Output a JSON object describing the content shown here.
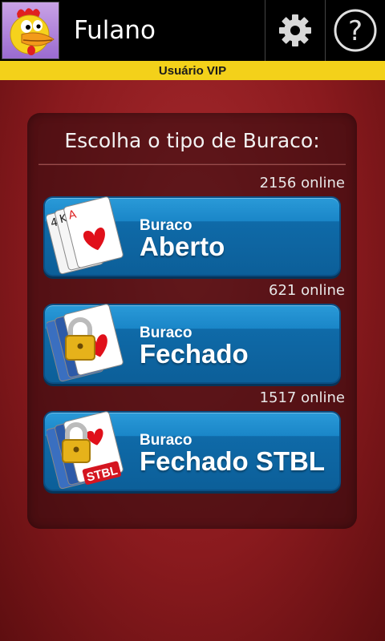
{
  "header": {
    "username": "Fulano",
    "settings_icon": "gear-icon",
    "help_icon": "question-icon",
    "vip_label": "Usuário VIP"
  },
  "panel": {
    "title": "Escolha o tipo de Buraco:",
    "options": [
      {
        "online": "2156 online",
        "subtitle": "Buraco",
        "title": "Aberto",
        "icon": "open-cards-icon"
      },
      {
        "online": "621 online",
        "subtitle": "Buraco",
        "title": "Fechado",
        "icon": "locked-cards-icon"
      },
      {
        "online": "1517 online",
        "subtitle": "Buraco",
        "title": "Fechado STBL",
        "icon": "locked-cards-stbl-icon"
      }
    ]
  },
  "colors": {
    "background": "#8a1a1e",
    "topbar": "#000000",
    "vip_bar": "#f3d11a",
    "button": "#1a86c8"
  }
}
